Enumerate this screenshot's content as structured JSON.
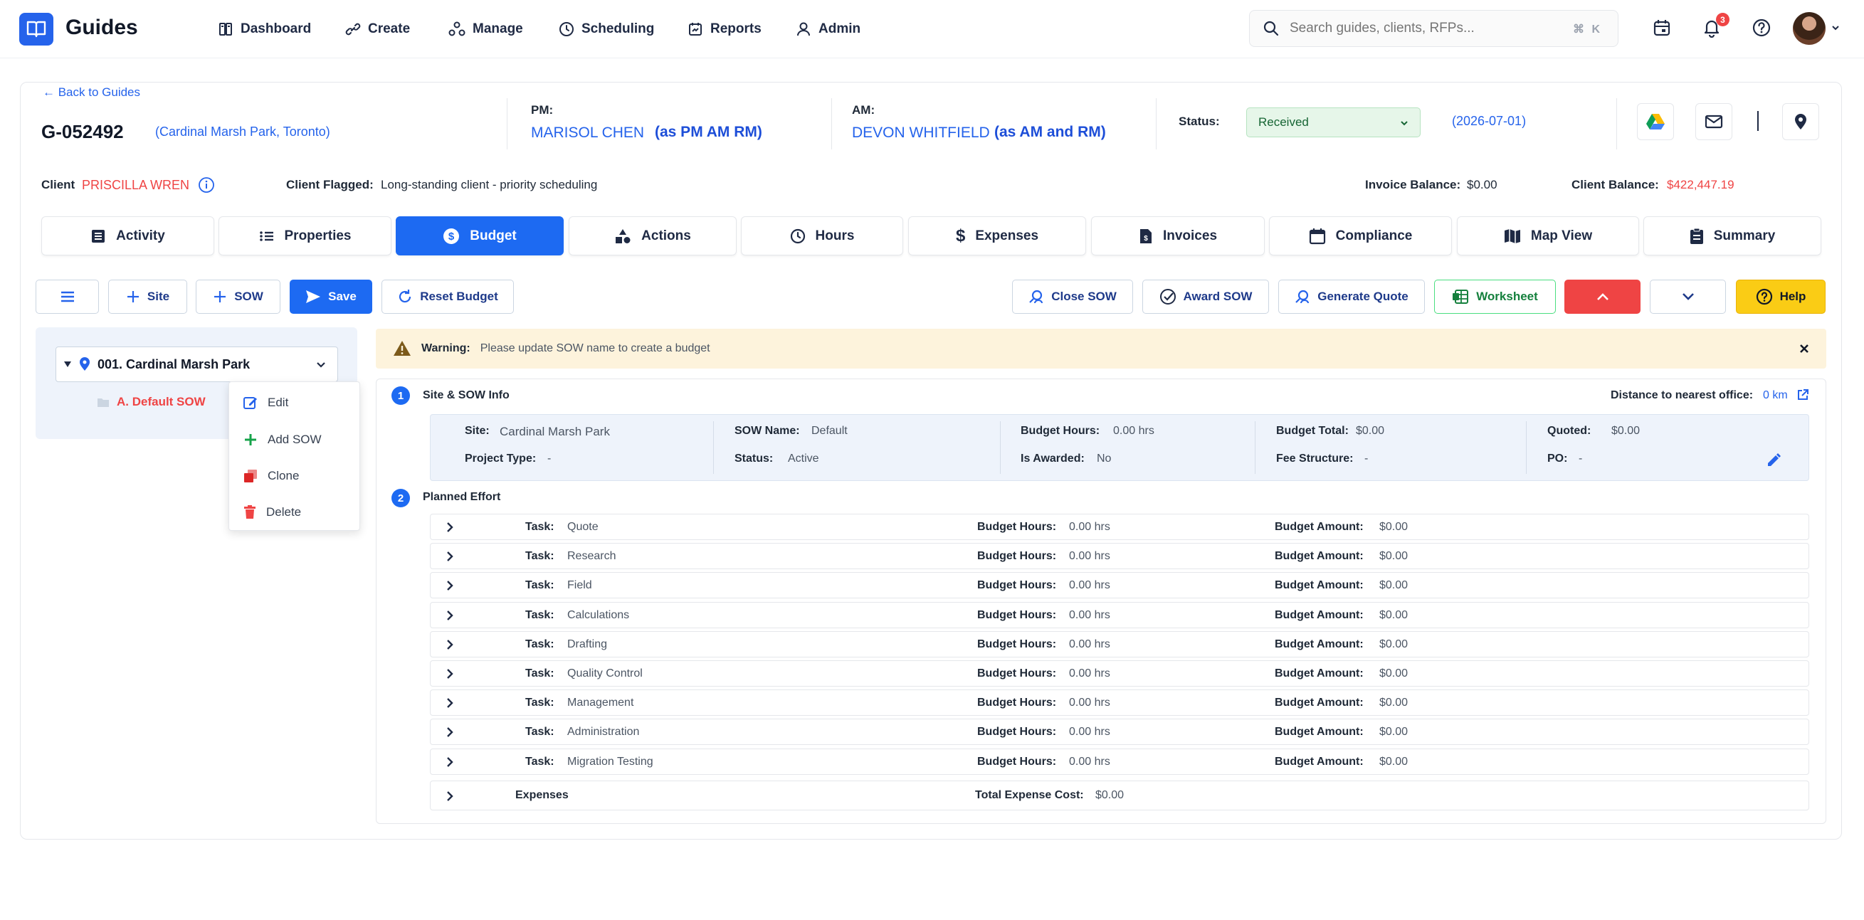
{
  "app": {
    "brand": "Guides"
  },
  "nav": [
    {
      "label": "Dashboard",
      "icon": "dashboard-icon"
    },
    {
      "label": "Create",
      "icon": "link-icon"
    },
    {
      "label": "Manage",
      "icon": "manage-icon"
    },
    {
      "label": "Scheduling",
      "icon": "clock-icon"
    },
    {
      "label": "Reports",
      "icon": "reports-icon"
    },
    {
      "label": "Admin",
      "icon": "user-icon"
    }
  ],
  "search": {
    "placeholder": "Search guides, clients, RFPs...",
    "shortcut": "⌘ K"
  },
  "notifications": {
    "count": "3"
  },
  "guide": {
    "back_label": "← Back to Guides",
    "id": "G-052492",
    "location": "(Cardinal Marsh Park, Toronto)",
    "pm_label": "PM:",
    "pm_name": "MARISOL CHEN",
    "pm_role": "(as PM AM RM)",
    "am_label": "AM:",
    "am_name": "DEVON WHITFIELD",
    "am_role": "(as AM and RM)",
    "status_label": "Status:",
    "status_value": "Received",
    "status_date": "(2026-07-01)"
  },
  "client": {
    "label": "Client",
    "name": "PRISCILLA WREN",
    "flagged_label": "Client Flagged:",
    "flagged_value": "Long-standing client - priority scheduling",
    "invoice_balance_label": "Invoice Balance:",
    "invoice_balance": "$0.00",
    "client_balance_label": "Client Balance:",
    "client_balance": "$422,447.19"
  },
  "tabs": [
    {
      "label": "Activity"
    },
    {
      "label": "Properties"
    },
    {
      "label": "Budget"
    },
    {
      "label": "Actions"
    },
    {
      "label": "Hours"
    },
    {
      "label": "Expenses"
    },
    {
      "label": "Invoices"
    },
    {
      "label": "Compliance"
    },
    {
      "label": "Map View"
    },
    {
      "label": "Summary"
    }
  ],
  "toolbar": {
    "site": "Site",
    "sow": "SOW",
    "save": "Save",
    "reset": "Reset Budget",
    "close_sow": "Close SOW",
    "award_sow": "Award SOW",
    "generate_quote": "Generate Quote",
    "worksheet": "Worksheet",
    "help": "Help"
  },
  "tree": {
    "site": "001. Cardinal Marsh Park",
    "sow": "A. Default SOW"
  },
  "context_menu": [
    "Edit",
    "Add SOW",
    "Clone",
    "Delete"
  ],
  "warning": {
    "label": "Warning:",
    "text": "Please update SOW name to create a budget"
  },
  "site_info": {
    "step": "1",
    "title": "Site & SOW Info",
    "distance_label": "Distance to nearest office:",
    "distance_value": "0 km",
    "site_label": "Site:",
    "site_value": "Cardinal Marsh Park",
    "sow_label": "SOW Name:",
    "sow_value": "Default",
    "hours_label": "Budget Hours:",
    "hours_value": "0.00 hrs",
    "total_label": "Budget Total:",
    "total_value": "$0.00",
    "quoted_label": "Quoted:",
    "quoted_value": "$0.00",
    "ptype_label": "Project Type:",
    "ptype_value": "-",
    "status_label": "Status:",
    "status_value": "Active",
    "awarded_label": "Is Awarded:",
    "awarded_value": "No",
    "fee_label": "Fee Structure:",
    "fee_value": "-",
    "po_label": "PO:",
    "po_value": "-"
  },
  "planned": {
    "step": "2",
    "title": "Planned Effort",
    "task_label": "Task:",
    "hours_label": "Budget Hours:",
    "amount_label": "Budget Amount:",
    "tasks": [
      {
        "name": "Quote",
        "hours": "0.00 hrs",
        "amount": "$0.00"
      },
      {
        "name": "Research",
        "hours": "0.00 hrs",
        "amount": "$0.00"
      },
      {
        "name": "Field",
        "hours": "0.00 hrs",
        "amount": "$0.00"
      },
      {
        "name": "Calculations",
        "hours": "0.00 hrs",
        "amount": "$0.00"
      },
      {
        "name": "Drafting",
        "hours": "0.00 hrs",
        "amount": "$0.00"
      },
      {
        "name": "Quality Control",
        "hours": "0.00 hrs",
        "amount": "$0.00"
      },
      {
        "name": "Management",
        "hours": "0.00 hrs",
        "amount": "$0.00"
      },
      {
        "name": "Administration",
        "hours": "0.00 hrs",
        "amount": "$0.00"
      },
      {
        "name": "Migration Testing",
        "hours": "0.00 hrs",
        "amount": "$0.00"
      }
    ],
    "expenses_label": "Expenses",
    "expense_cost_label": "Total Expense Cost:",
    "expense_cost": "$0.00"
  },
  "colors": {
    "accent": "#1d6af2",
    "danger": "#ef4444",
    "success_bg": "#e6f6e9",
    "warning_bg": "#fdf3dc",
    "help_yellow": "#facc15"
  }
}
